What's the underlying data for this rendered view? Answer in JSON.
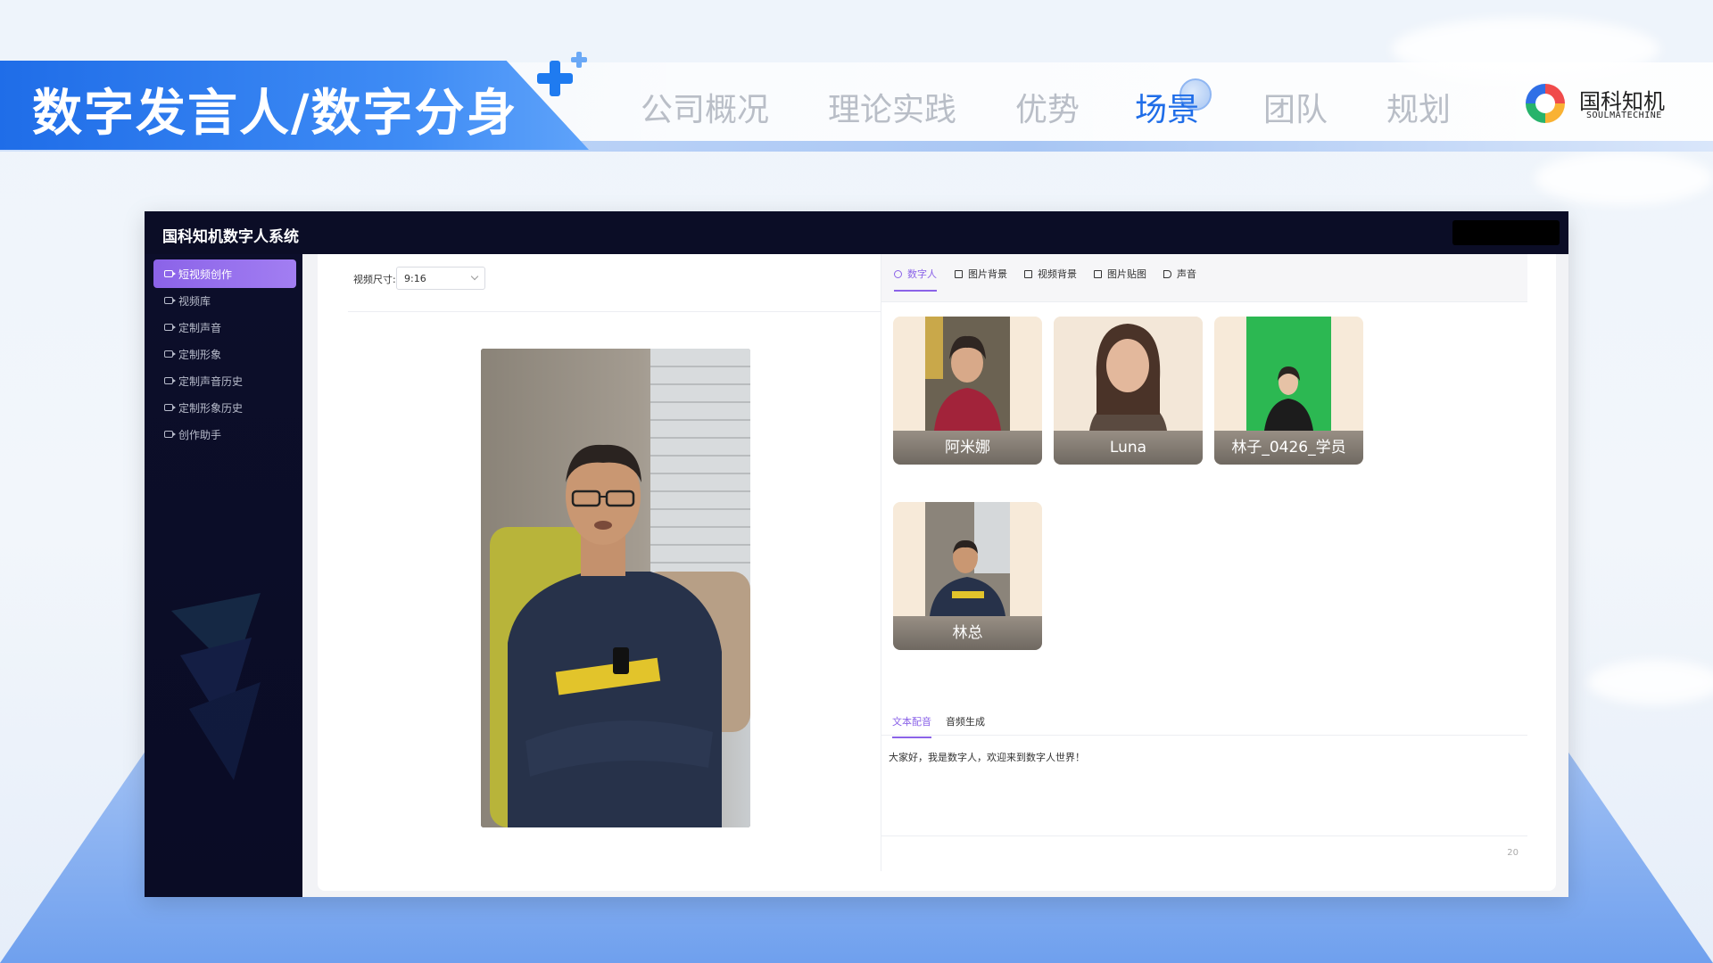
{
  "slide": {
    "title": "数字发言人/数字分身",
    "nav": [
      "公司概况",
      "理论实践",
      "优势",
      "场景",
      "团队",
      "规划"
    ],
    "nav_active_index": 3,
    "brand_name": "国科知机",
    "brand_sub": "SOULMATECHINE",
    "accent_color": "#1f6de8"
  },
  "app": {
    "title": "国科知机数字人系统",
    "sidebar": {
      "items": [
        {
          "label": "短视频创作",
          "icon": "video-icon",
          "active": true
        },
        {
          "label": "视频库",
          "icon": "video-icon"
        },
        {
          "label": "定制声音",
          "icon": "video-icon"
        },
        {
          "label": "定制形象",
          "icon": "video-icon"
        },
        {
          "label": "定制声音历史",
          "icon": "video-icon"
        },
        {
          "label": "定制形象历史",
          "icon": "video-icon"
        },
        {
          "label": "创作助手",
          "icon": "video-icon"
        }
      ]
    },
    "video_size": {
      "label": "视频尺寸:",
      "value": "9:16"
    },
    "asset_tabs": [
      {
        "label": "数字人",
        "icon": "user-icon",
        "active": true
      },
      {
        "label": "图片背景",
        "icon": "grid-icon"
      },
      {
        "label": "视频背景",
        "icon": "grid-icon"
      },
      {
        "label": "图片贴图",
        "icon": "image-icon"
      },
      {
        "label": "声音",
        "icon": "speaker-icon"
      }
    ],
    "avatars": [
      {
        "name": "阿米娜"
      },
      {
        "name": "Luna"
      },
      {
        "name": "林子_0426_学员"
      },
      {
        "name": "林总"
      }
    ],
    "script_tabs": [
      {
        "label": "文本配音",
        "active": true
      },
      {
        "label": "音频生成"
      }
    ],
    "script_text": "大家好，我是数字人，欢迎来到数字人世界！",
    "char_count": "20",
    "highlight_color": "#8b63e8"
  }
}
